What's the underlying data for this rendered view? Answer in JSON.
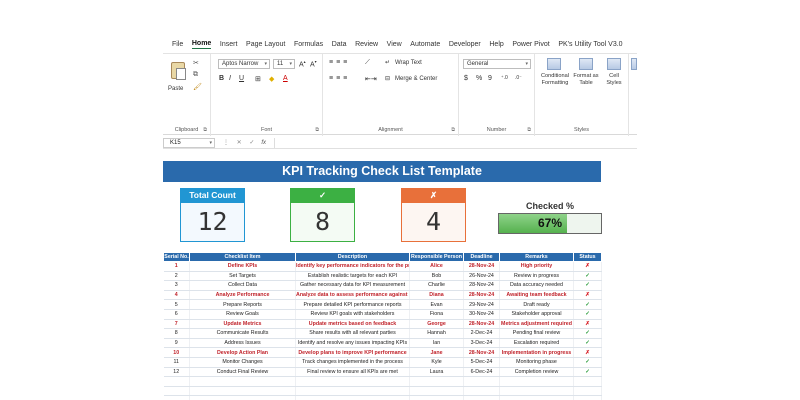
{
  "menu": [
    "File",
    "Home",
    "Insert",
    "Page Layout",
    "Formulas",
    "Data",
    "Review",
    "View",
    "Automate",
    "Developer",
    "Help",
    "Power Pivot",
    "PK's Utility Tool V3.0"
  ],
  "active_menu": "Home",
  "ribbon": {
    "clipboard": {
      "paste": "Paste",
      "label": "Clipboard"
    },
    "font": {
      "name": "Aptos Narrow",
      "size": "11",
      "label": "Font",
      "bold": "B",
      "italic": "I",
      "underline": "U"
    },
    "alignment": {
      "wrap": "Wrap Text",
      "merge": "Merge & Center",
      "label": "Alignment"
    },
    "number": {
      "format": "General",
      "label": "Number",
      "currency": "$",
      "percent": "%",
      "comma": "9"
    },
    "styles": {
      "conditional_1": "Conditional",
      "conditional_2": "Formatting",
      "format_table_1": "Format as",
      "format_table_2": "Table",
      "cell_styles_1": "Cell",
      "cell_styles_2": "Styles",
      "label": "Styles"
    }
  },
  "formula_bar": {
    "cell_ref": "K15",
    "fx": "fx",
    "value": ""
  },
  "sheet": {
    "title": "KPI Tracking Check List Template",
    "cards": {
      "total": {
        "label": "Total Count",
        "value": "12"
      },
      "checked": {
        "label": "✓",
        "value": "8"
      },
      "unchecked": {
        "label": "✗",
        "value": "4"
      }
    },
    "checked_pct": {
      "label": "Checked %",
      "text": "67%",
      "fraction": 0.67
    }
  },
  "table": {
    "headers": [
      "Serial No.",
      "Checklist Item",
      "Description",
      "Responsible Person",
      "Deadline",
      "Remarks",
      "Status"
    ],
    "rows": [
      {
        "serial": "1",
        "item": "Define KPIs",
        "description": "Identify key performance indicators for the project",
        "person": "Alice",
        "deadline": "28-Nov-24",
        "remarks": "High priority",
        "status": "✗"
      },
      {
        "serial": "2",
        "item": "Set Targets",
        "description": "Establish realistic targets for each KPI",
        "person": "Bob",
        "deadline": "26-Nov-24",
        "remarks": "Review in progress",
        "status": "✓"
      },
      {
        "serial": "3",
        "item": "Collect Data",
        "description": "Gather necessary data for KPI measurement",
        "person": "Charlie",
        "deadline": "28-Nov-24",
        "remarks": "Data accuracy needed",
        "status": "✓"
      },
      {
        "serial": "4",
        "item": "Analyze Performance",
        "description": "Analyze data to assess performance against targets",
        "person": "Diana",
        "deadline": "28-Nov-24",
        "remarks": "Awaiting team feedback",
        "status": "✗"
      },
      {
        "serial": "5",
        "item": "Prepare Reports",
        "description": "Prepare detailed KPI performance reports",
        "person": "Evan",
        "deadline": "29-Nov-24",
        "remarks": "Draft ready",
        "status": "✓"
      },
      {
        "serial": "6",
        "item": "Review Goals",
        "description": "Review KPI goals with stakeholders",
        "person": "Fiona",
        "deadline": "30-Nov-24",
        "remarks": "Stakeholder approval",
        "status": "✓"
      },
      {
        "serial": "7",
        "item": "Update Metrics",
        "description": "Update metrics based on feedback",
        "person": "George",
        "deadline": "28-Nov-24",
        "remarks": "Metrics adjustment required",
        "status": "✗"
      },
      {
        "serial": "8",
        "item": "Communicate Results",
        "description": "Share results with all relevant parties",
        "person": "Hannah",
        "deadline": "2-Dec-24",
        "remarks": "Pending final review",
        "status": "✓"
      },
      {
        "serial": "9",
        "item": "Address Issues",
        "description": "Identify and resolve any issues impacting KPIs",
        "person": "Ian",
        "deadline": "3-Dec-24",
        "remarks": "Escalation required",
        "status": "✓"
      },
      {
        "serial": "10",
        "item": "Develop Action Plan",
        "description": "Develop plans to improve KPI performance",
        "person": "Jane",
        "deadline": "28-Nov-24",
        "remarks": "Implementation in progress",
        "status": "✗"
      },
      {
        "serial": "11",
        "item": "Monitor Changes",
        "description": "Track changes implemented in the process",
        "person": "Kyle",
        "deadline": "5-Dec-24",
        "remarks": "Monitoring phase",
        "status": "✓"
      },
      {
        "serial": "12",
        "item": "Conduct Final Review",
        "description": "Final review to ensure all KPIs are met",
        "person": "Laura",
        "deadline": "6-Dec-24",
        "remarks": "Completion review",
        "status": "✓"
      }
    ],
    "empty_rows": 3
  },
  "colors": {
    "header_blue": "#2a6aac",
    "total_blue": "#2196d3",
    "checked_green": "#3cb043",
    "unchecked_orange": "#e8703a",
    "pending_red": "#c0232b",
    "done_green": "#2e9e3e"
  }
}
